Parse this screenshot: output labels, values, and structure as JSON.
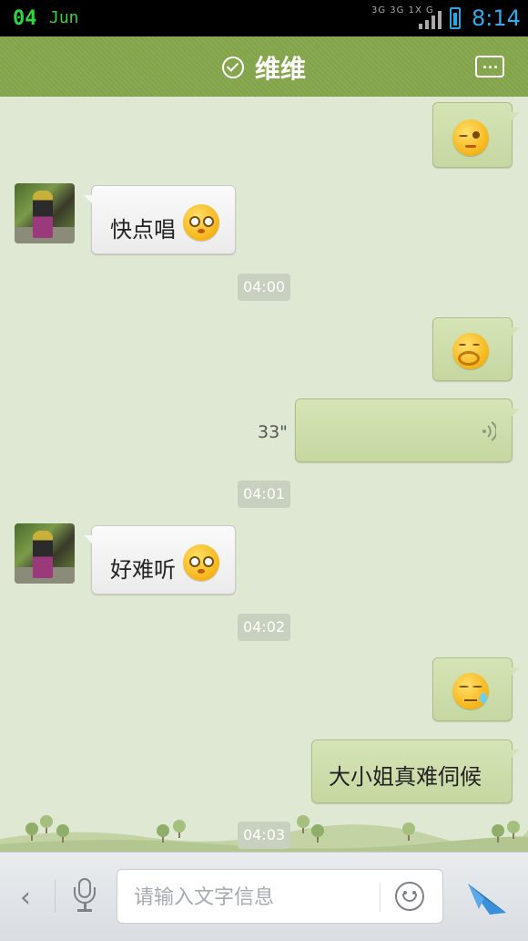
{
  "status_bar": {
    "day": "04",
    "month": "Jun",
    "network": "3G 3G 1X G",
    "time": "8:14"
  },
  "header": {
    "title": "维维"
  },
  "messages": [
    {
      "side": "out",
      "type": "emoji",
      "emoji": "smirk-wink-emoji"
    },
    {
      "side": "in",
      "type": "text",
      "text": "快点唱",
      "emoji": "puppy-eyes-emoji"
    },
    {
      "type": "time",
      "text": "04:00"
    },
    {
      "side": "out",
      "type": "emoji",
      "emoji": "hand-over-mouth-emoji"
    },
    {
      "side": "out",
      "type": "voice",
      "duration": "33\""
    },
    {
      "type": "time",
      "text": "04:01"
    },
    {
      "side": "in",
      "type": "text",
      "text": "好难听",
      "emoji": "puppy-eyes-emoji"
    },
    {
      "type": "time",
      "text": "04:02"
    },
    {
      "side": "out",
      "type": "emoji",
      "emoji": "sweat-face-emoji"
    },
    {
      "side": "out",
      "type": "text",
      "text": "大小姐真难伺候"
    },
    {
      "type": "time",
      "text": "04:03"
    }
  ],
  "input_bar": {
    "placeholder": "请输入文字信息"
  },
  "colors": {
    "header": "#86a650",
    "chat_bg": "#dfe8d2",
    "bubble_out": "#cfdeb0",
    "bubble_in": "#f4f4f4",
    "send_icon": "#3a8fd8"
  }
}
